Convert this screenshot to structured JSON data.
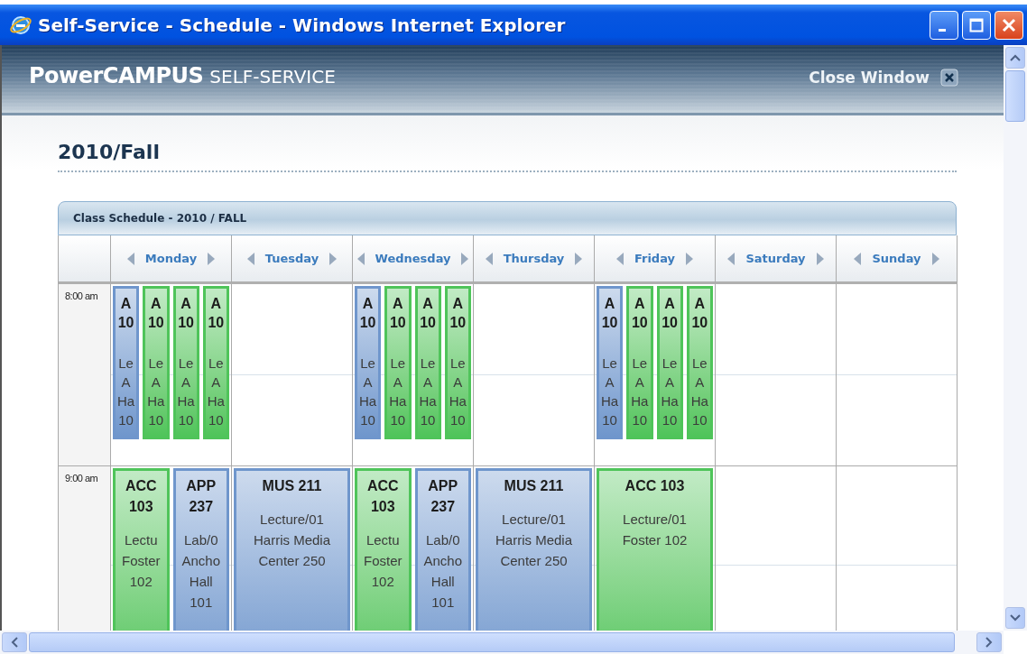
{
  "window": {
    "title": "Self-Service - Schedule - Windows Internet Explorer"
  },
  "header": {
    "brand": "PowerCAMPUS",
    "brand_suffix": "SELF-SERVICE",
    "close_link": "Close Window"
  },
  "term_heading": "2010/Fall",
  "schedule": {
    "title": "Class Schedule - 2010 / FALL",
    "days": [
      {
        "name": "Monday"
      },
      {
        "name": "Tuesday"
      },
      {
        "name": "Wednesday"
      },
      {
        "name": "Thursday"
      },
      {
        "name": "Friday"
      },
      {
        "name": "Saturday"
      },
      {
        "name": "Sunday"
      }
    ],
    "rows": [
      {
        "time": "8:00 am",
        "cells": [
          [
            {
              "title": [
                "A",
                "10"
              ],
              "details": [
                "Le",
                "A",
                "Ha",
                "10"
              ],
              "color": "#6f96cc"
            },
            {
              "title": [
                "A",
                "10"
              ],
              "details": [
                "Le",
                "A",
                "Ha",
                "10"
              ],
              "color": "#4fc45a"
            },
            {
              "title": [
                "A",
                "10"
              ],
              "details": [
                "Le",
                "A",
                "Ha",
                "10"
              ],
              "color": "#4fc45a"
            },
            {
              "title": [
                "A",
                "10"
              ],
              "details": [
                "Le",
                "A",
                "Ha",
                "10"
              ],
              "color": "#4fc45a"
            }
          ],
          [],
          [
            {
              "title": [
                "A",
                "10"
              ],
              "details": [
                "Le",
                "A",
                "Ha",
                "10"
              ],
              "color": "#6f96cc"
            },
            {
              "title": [
                "A",
                "10"
              ],
              "details": [
                "Le",
                "A",
                "Ha",
                "10"
              ],
              "color": "#4fc45a"
            },
            {
              "title": [
                "A",
                "10"
              ],
              "details": [
                "Le",
                "A",
                "Ha",
                "10"
              ],
              "color": "#4fc45a"
            },
            {
              "title": [
                "A",
                "10"
              ],
              "details": [
                "Le",
                "A",
                "Ha",
                "10"
              ],
              "color": "#4fc45a"
            }
          ],
          [],
          [
            {
              "title": [
                "A",
                "10"
              ],
              "details": [
                "Le",
                "A",
                "Ha",
                "10"
              ],
              "color": "#6f96cc"
            },
            {
              "title": [
                "A",
                "10"
              ],
              "details": [
                "Le",
                "A",
                "Ha",
                "10"
              ],
              "color": "#4fc45a"
            },
            {
              "title": [
                "A",
                "10"
              ],
              "details": [
                "Le",
                "A",
                "Ha",
                "10"
              ],
              "color": "#4fc45a"
            },
            {
              "title": [
                "A",
                "10"
              ],
              "details": [
                "Le",
                "A",
                "Ha",
                "10"
              ],
              "color": "#4fc45a"
            }
          ],
          [],
          []
        ]
      },
      {
        "time": "9:00 am",
        "cells": [
          [
            {
              "title": [
                "ACC",
                "103"
              ],
              "details": [
                "Lectu",
                "Foster",
                "102"
              ],
              "color": "#4fc45a"
            },
            {
              "title": [
                "APP",
                "237"
              ],
              "details": [
                "Lab/0",
                "Ancho",
                "Hall",
                "101"
              ],
              "color": "#6f96cc"
            }
          ],
          [
            {
              "title": [
                "MUS 211"
              ],
              "details": [
                "Lecture/01",
                "Harris Media",
                "Center 250"
              ],
              "color": "#6f96cc"
            }
          ],
          [
            {
              "title": [
                "ACC",
                "103"
              ],
              "details": [
                "Lectu",
                "Foster",
                "102"
              ],
              "color": "#4fc45a"
            },
            {
              "title": [
                "APP",
                "237"
              ],
              "details": [
                "Lab/0",
                "Ancho",
                "Hall",
                "101"
              ],
              "color": "#6f96cc"
            }
          ],
          [
            {
              "title": [
                "MUS 211"
              ],
              "details": [
                "Lecture/01",
                "Harris Media",
                "Center 250"
              ],
              "color": "#6f96cc"
            }
          ],
          [
            {
              "title": [
                "ACC 103"
              ],
              "details": [
                "Lecture/01",
                "Foster 102"
              ],
              "color": "#4fc45a"
            }
          ],
          [],
          []
        ]
      }
    ]
  }
}
